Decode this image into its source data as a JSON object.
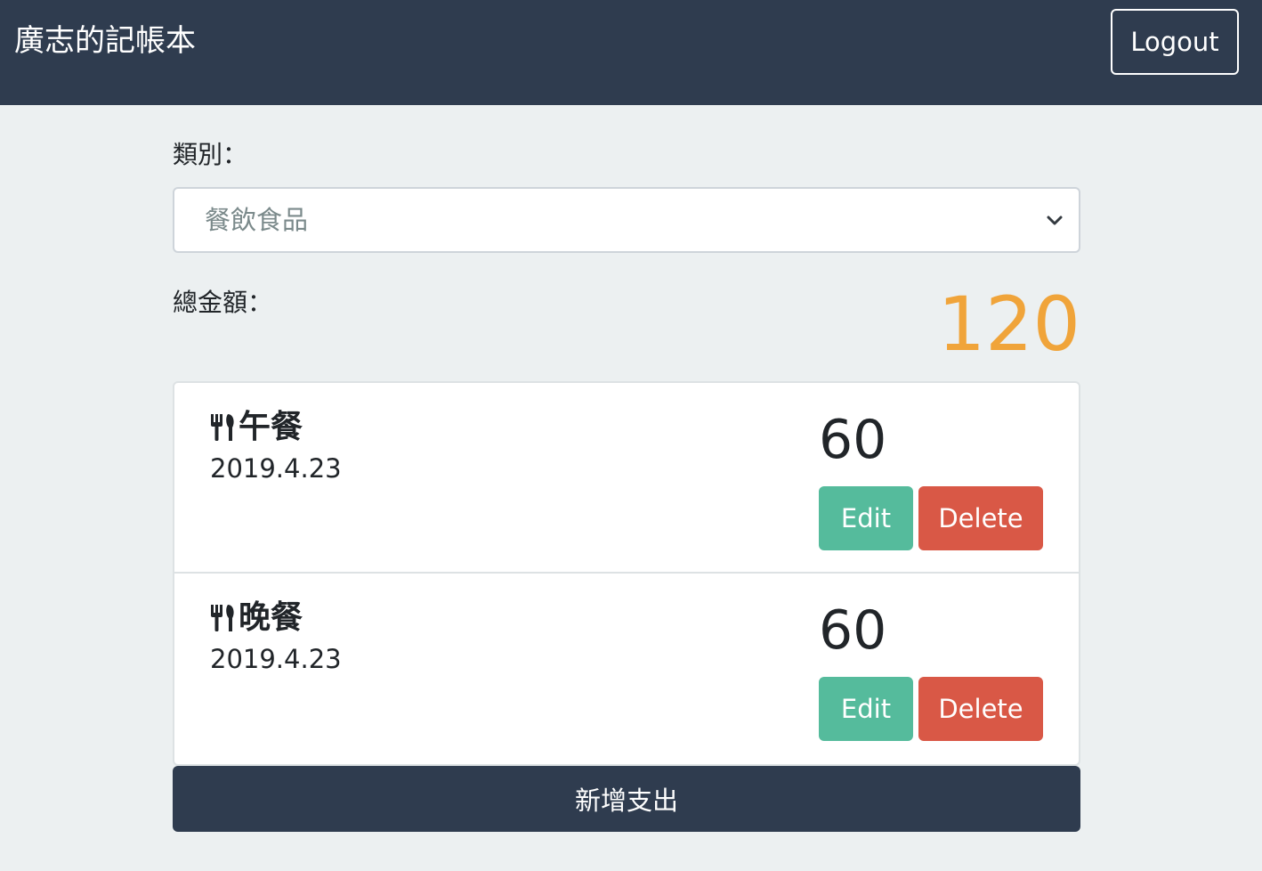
{
  "navbar": {
    "brand": "廣志的記帳本",
    "logout_label": "Logout"
  },
  "form": {
    "category_label": "類別：",
    "category_selected": "餐飲食品",
    "total_label": "總金額：",
    "total_amount": "120"
  },
  "records": [
    {
      "icon": "utensils-icon",
      "name": "午餐",
      "date": "2019.4.23",
      "amount": "60",
      "edit_label": "Edit",
      "delete_label": "Delete"
    },
    {
      "icon": "utensils-icon",
      "name": "晚餐",
      "date": "2019.4.23",
      "amount": "60",
      "edit_label": "Edit",
      "delete_label": "Delete"
    }
  ],
  "add_button_label": "新增支出",
  "colors": {
    "navbar": "#2f3c4f",
    "background": "#ecf0f1",
    "total_amount": "#f0a43a",
    "edit_button": "#55bb9c",
    "delete_button": "#d95846"
  }
}
